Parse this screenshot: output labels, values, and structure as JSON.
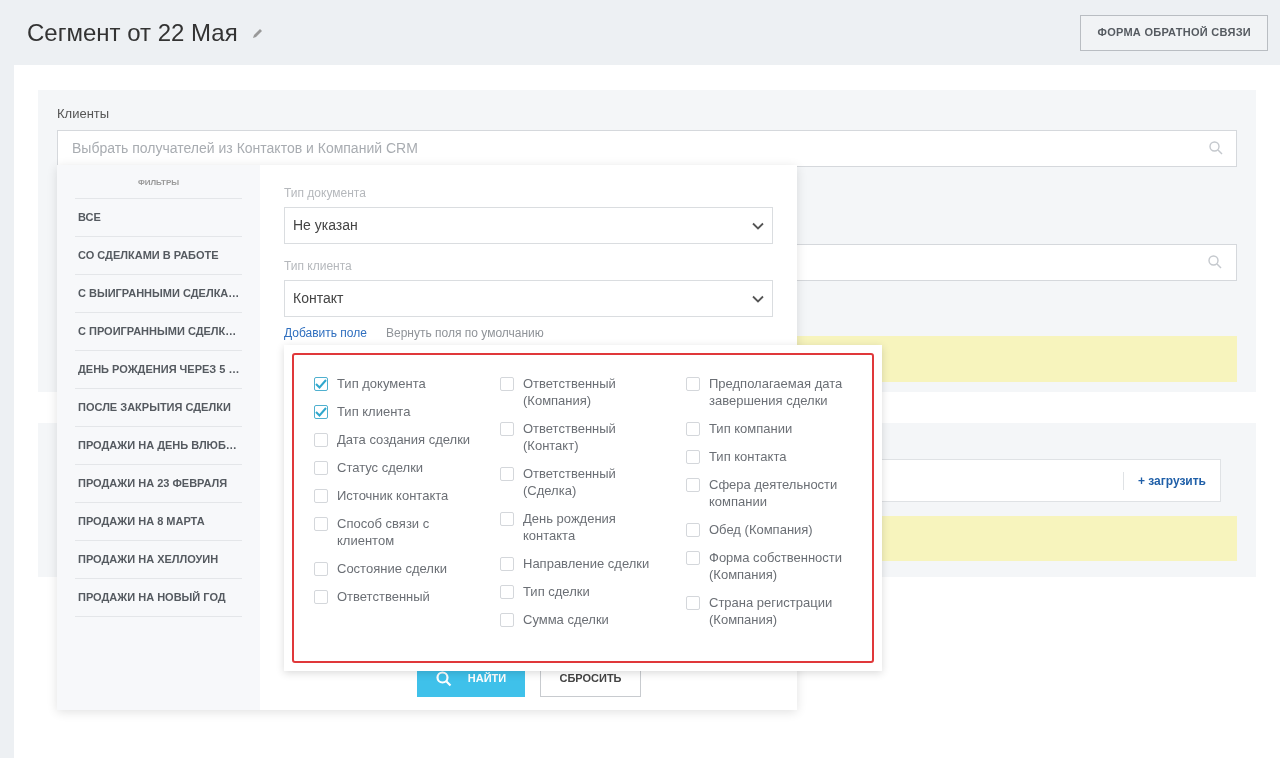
{
  "header": {
    "title": "Сегмент от 22 Мая",
    "feedback_button": "ФОРМА ОБРАТНОЙ СВЯЗИ"
  },
  "clients": {
    "label": "Клиенты",
    "search": {
      "placeholder": "Выбрать получателей из Контактов и Компаний CRM"
    }
  },
  "upload": {
    "button": "+ загрузить"
  },
  "filters_panel": {
    "heading": "ФИЛЬТРЫ",
    "items": [
      "ВСЕ",
      "СО СДЕЛКАМИ В РАБОТЕ",
      "С ВЫИГРАННЫМИ СДЕЛКА…",
      "С ПРОИГРАННЫМИ СДЕЛК…",
      "ДЕНЬ РОЖДЕНИЯ ЧЕРЕЗ 5 …",
      "ПОСЛЕ ЗАКРЫТИЯ СДЕЛКИ",
      "ПРОДАЖИ НА ДЕНЬ ВЛЮБ…",
      "ПРОДАЖИ НА 23 ФЕВРАЛЯ",
      "ПРОДАЖИ НА 8 МАРТА",
      "ПРОДАЖИ НА ХЕЛЛОУИН",
      "ПРОДАЖИ НА НОВЫЙ ГОД"
    ],
    "fields": [
      {
        "label": "Тип документа",
        "value": "Не указан"
      },
      {
        "label": "Тип клиента",
        "value": "Контакт"
      }
    ],
    "add_field_link": "Добавить поле",
    "reset_fields_link": "Вернуть поля по умолчанию",
    "find_button": "НАЙТИ",
    "reset_button": "СБРОСИТЬ"
  },
  "field_picker": {
    "columns": [
      [
        {
          "label": "Тип документа",
          "checked": true
        },
        {
          "label": "Тип клиента",
          "checked": true
        },
        {
          "label": "Дата создания сделки",
          "checked": false
        },
        {
          "label": "Статус сделки",
          "checked": false
        },
        {
          "label": "Источник контакта",
          "checked": false
        },
        {
          "label": "Способ связи с клиентом",
          "checked": false
        },
        {
          "label": "Состояние сделки",
          "checked": false
        },
        {
          "label": "Ответственный",
          "checked": false
        }
      ],
      [
        {
          "label": "Ответственный (Компания)",
          "checked": false
        },
        {
          "label": "Ответственный (Контакт)",
          "checked": false
        },
        {
          "label": "Ответственный (Сделка)",
          "checked": false
        },
        {
          "label": "День рождения контакта",
          "checked": false
        },
        {
          "label": "Направление сделки",
          "checked": false
        },
        {
          "label": "Тип сделки",
          "checked": false
        },
        {
          "label": "Сумма сделки",
          "checked": false
        }
      ],
      [
        {
          "label": "Предполагаемая дата завершения сделки",
          "checked": false
        },
        {
          "label": "Тип компании",
          "checked": false
        },
        {
          "label": "Тип контакта",
          "checked": false
        },
        {
          "label": "Сфера деятельности компании",
          "checked": false
        },
        {
          "label": "Обед (Компания)",
          "checked": false
        },
        {
          "label": "Форма собственности (Компания)",
          "checked": false
        },
        {
          "label": "Страна регистрации (Компания)",
          "checked": false
        }
      ]
    ]
  }
}
